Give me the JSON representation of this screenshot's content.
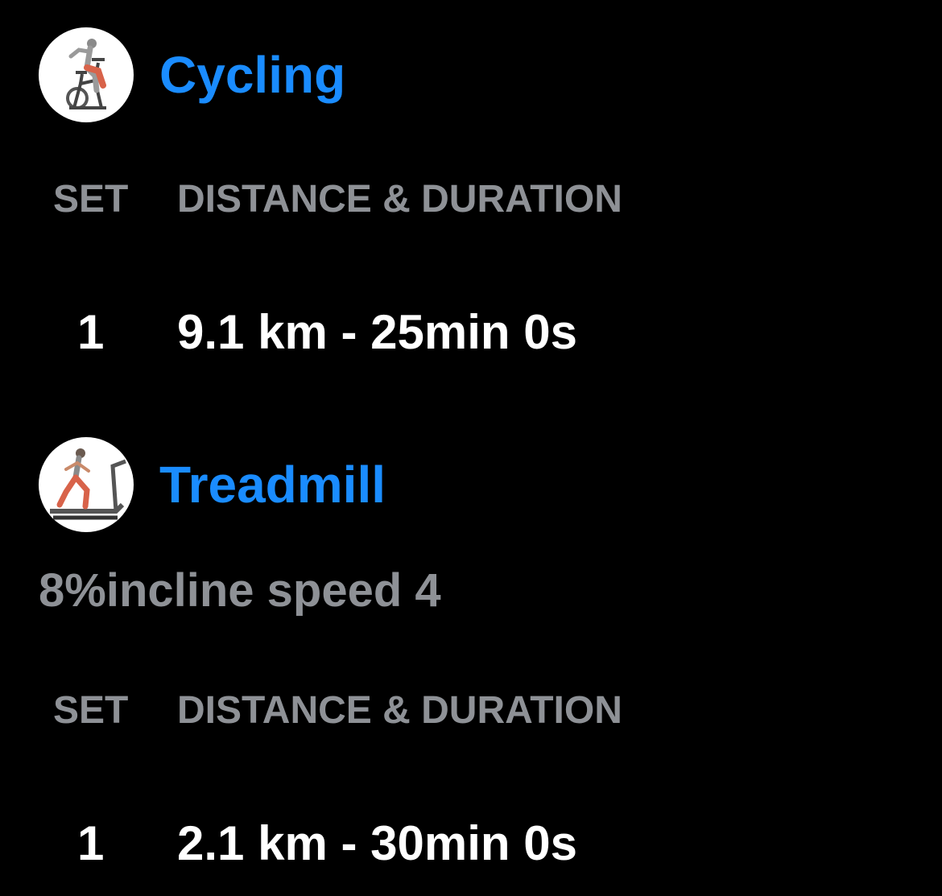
{
  "colors": {
    "background": "#000000",
    "title": "#1a8cff",
    "secondary_text": "#8e9196",
    "primary_text": "#ffffff"
  },
  "exercises": [
    {
      "name": "Cycling",
      "image_icon": "stationary-bike-exercise-icon",
      "note": "",
      "columns": {
        "set": "SET",
        "value": "DISTANCE & DURATION"
      },
      "sets": [
        {
          "set": "1",
          "value": "9.1 km - 25min 0s"
        }
      ]
    },
    {
      "name": "Treadmill",
      "image_icon": "treadmill-exercise-icon",
      "note": "8%incline speed 4",
      "columns": {
        "set": "SET",
        "value": "DISTANCE & DURATION"
      },
      "sets": [
        {
          "set": "1",
          "value": "2.1 km - 30min 0s"
        }
      ]
    }
  ]
}
